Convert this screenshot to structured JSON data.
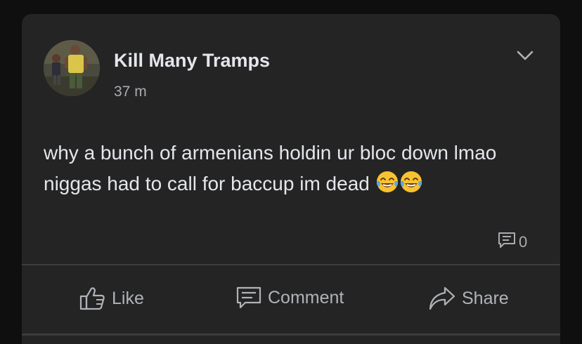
{
  "post": {
    "author": "Kill Many Tramps",
    "time": "37 m",
    "text": "why a bunch of armenians holdin ur bloc down lmao niggas had to call for baccup im dead",
    "emoji_count": 2,
    "comment_count": "0"
  },
  "actions": {
    "like_label": "Like",
    "comment_label": "Comment",
    "share_label": "Share"
  },
  "icons": {
    "menu": "chevron-down-icon",
    "like": "thumbs-up-icon",
    "comment": "comment-icon",
    "share": "share-arrow-icon",
    "emoji": "face-with-tears-of-joy"
  },
  "colors": {
    "background": "#0f0f0f",
    "card": "#242424",
    "text_primary": "#e4e6eb",
    "text_secondary": "#a8abaf",
    "divider": "#3b3c3e"
  }
}
